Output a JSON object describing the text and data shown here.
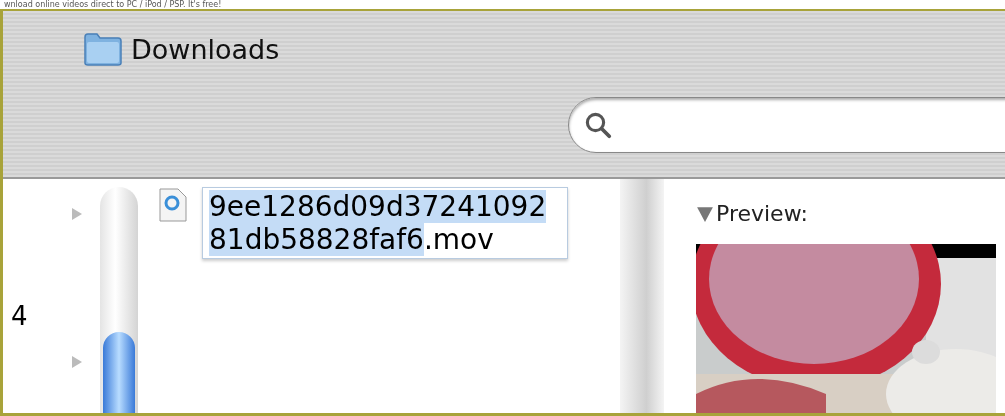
{
  "banner": {
    "text": "wnload online videos direct to PC / iPod / PSP. It's free!"
  },
  "toolbar": {
    "location": "Downloads"
  },
  "sidebar": {
    "row_label": "4"
  },
  "file": {
    "selected_text": "9ee1286d09d3724109281db58828faf6",
    "unselected_text": ".mov"
  },
  "preview": {
    "title": "Preview:",
    "expanded": true
  }
}
